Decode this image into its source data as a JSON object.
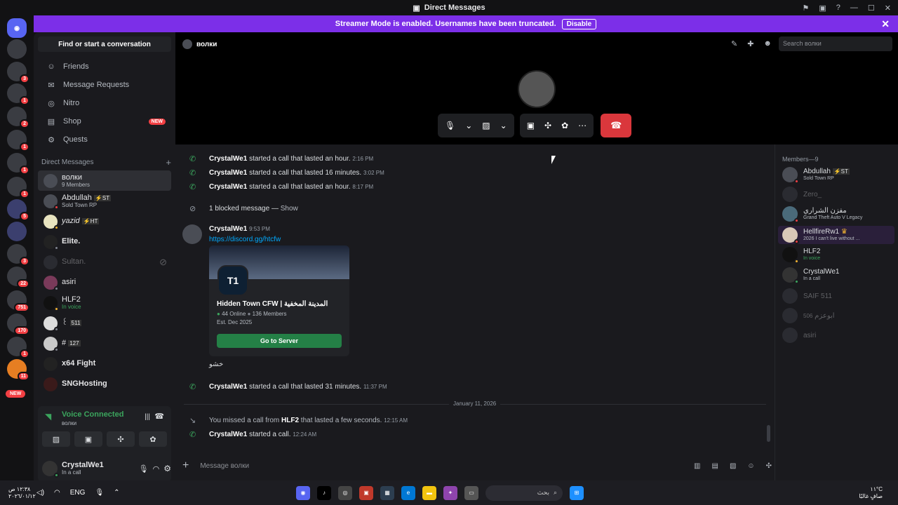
{
  "titlebar": {
    "title": "Direct Messages"
  },
  "banner": {
    "text": "Streamer Mode is enabled. Usernames have been truncated.",
    "button": "Disable"
  },
  "guilds": {
    "badges": [
      "3",
      "1",
      "2",
      "1",
      "1",
      "1",
      "5",
      "3",
      "3",
      "22",
      "751",
      "170",
      "1",
      "11"
    ],
    "new_label": "NEW"
  },
  "sidebar": {
    "search": "Find or start a conversation",
    "nav": [
      {
        "label": "Friends",
        "icon": "friends-icon"
      },
      {
        "label": "Message Requests",
        "icon": "mail-icon"
      },
      {
        "label": "Nitro",
        "icon": "nitro-icon"
      },
      {
        "label": "Shop",
        "icon": "shop-icon",
        "badge": "NEW"
      },
      {
        "label": "Quests",
        "icon": "quests-icon"
      }
    ],
    "dm_header": "Direct Messages",
    "dms": [
      {
        "name": "волки",
        "sub": "9 Members"
      },
      {
        "name": "Abdullah",
        "tag": "⚡ST",
        "sub": "Sold Town RP"
      },
      {
        "name": "yazid",
        "tag": "⚡HT",
        "sub": ""
      },
      {
        "name": "Elite.",
        "sub": ""
      },
      {
        "name": "Sultan.",
        "sub": ""
      },
      {
        "name": "asiri",
        "sub": ""
      },
      {
        "name": "HLF2",
        "sub": "In voice"
      },
      {
        "name": "꒰",
        "tag": "511",
        "sub": ""
      },
      {
        "name": "#",
        "tag": "127",
        "sub": ""
      },
      {
        "name": "x64 Fight",
        "sub": ""
      },
      {
        "name": "SNGHosting",
        "sub": ""
      }
    ]
  },
  "voice": {
    "title": "Voice Connected",
    "channel": "волки"
  },
  "user": {
    "name": "CrystalWe1",
    "status": "In a call"
  },
  "channel": {
    "name": "волки",
    "search_placeholder": "Search волки"
  },
  "messages": {
    "m1": {
      "author": "CrystalWe1",
      "text": "started a call that lasted an hour.",
      "time": "2:16 PM"
    },
    "m2": {
      "author": "CrystalWe1",
      "text": "started a call that lasted 16 minutes.",
      "time": "3:02 PM"
    },
    "m3": {
      "author": "CrystalWe1",
      "text": "started a call that lasted an hour.",
      "time": "8:17 PM"
    },
    "blocked": {
      "text": "1 blocked message —",
      "show": "Show"
    },
    "m4": {
      "author": "CrystalWe1",
      "time": "9:53 PM",
      "link": "https://discord.gg/htcfw"
    },
    "embed": {
      "icon": "T1",
      "name": "Hidden Town CFW | المدينة المخفية",
      "online": "44 Online",
      "members": "136 Members",
      "est": "Est. Dec 2025",
      "button": "Go to Server"
    },
    "m5": {
      "text": "خشو"
    },
    "m6": {
      "author": "CrystalWe1",
      "text": "started a call that lasted 31 minutes.",
      "time": "11:37 PM"
    },
    "divider": "January 11, 2026",
    "m7": {
      "pre": "You missed a call from",
      "author": "HLF2",
      "text": "that lasted a few seconds.",
      "time": "12:15 AM"
    },
    "m8": {
      "author": "CrystalWe1",
      "text": "started a call.",
      "time": "12:24 AM"
    }
  },
  "input": {
    "placeholder": "Message волки"
  },
  "members": {
    "header": "Members—9",
    "list": [
      {
        "name": "Abdullah",
        "tag": "⚡ST",
        "sub": "Sold Town RP"
      },
      {
        "name": "Zero_",
        "sub": ""
      },
      {
        "name": "مفزن الشراري",
        "sub": "Grand Theft Auto V Legacy"
      },
      {
        "name": "HellfireRw1",
        "sub": "2026 I can't live without ..."
      },
      {
        "name": "HLF2",
        "sub": "In voice"
      },
      {
        "name": "CrystalWe1",
        "sub": "In a call"
      },
      {
        "name": "SAIF 511",
        "sub": ""
      },
      {
        "name": "ابوعزم",
        "tag": "506",
        "sub": ""
      },
      {
        "name": "asiri",
        "sub": ""
      }
    ]
  },
  "taskbar": {
    "time": "١٢:٣٨ ص",
    "date": "٢٠٢٦/٠١/١٢",
    "lang": "ENG",
    "search": "بحث",
    "weather_temp": "١١°C",
    "weather_text": "صافٍ غالبًا"
  }
}
